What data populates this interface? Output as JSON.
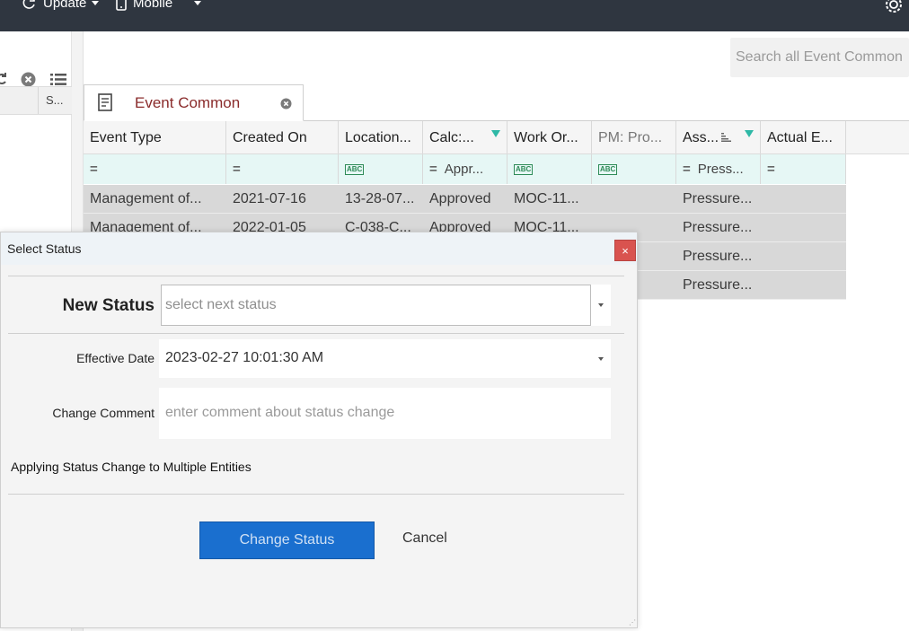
{
  "topbar": {
    "update_label": "Update",
    "mobile_label": "Mobile"
  },
  "left_pane": {
    "column_header": "S..."
  },
  "search": {
    "placeholder": "Search all Event Common"
  },
  "tab": {
    "title": "Event Common"
  },
  "grid": {
    "columns": [
      "Event Type",
      "Created On",
      "Location...",
      "Calc:...",
      "Work Or...",
      "PM: Pro...",
      "Ass...",
      "Actual E..."
    ],
    "filters": {
      "calc": "Appr...",
      "ass": "Press..."
    },
    "rows": [
      [
        "Management of...",
        "2021-07-16",
        "13-28-07...",
        "Approved",
        "MOC-11...",
        "",
        "Pressure...",
        ""
      ],
      [
        "Management of...",
        "2022-01-05",
        "C-038-C...",
        "Approved",
        "MOC-11...",
        "",
        "Pressure...",
        ""
      ],
      [
        "",
        "",
        "",
        "",
        "",
        "",
        "Pressure...",
        ""
      ],
      [
        "",
        "",
        "",
        "",
        "",
        "",
        "Pressure...",
        ""
      ]
    ]
  },
  "dialog": {
    "title": "Select Status",
    "close_glyph": "×",
    "new_status_label": "New Status",
    "new_status_placeholder": "select next status",
    "effective_date_label": "Effective Date",
    "effective_date_value": "2023-02-27 10:01:30 AM",
    "change_comment_label": "Change Comment",
    "change_comment_placeholder": "enter comment about status change",
    "multi_notice": "Applying Status Change to Multiple Entities",
    "change_button": "Change Status",
    "cancel_button": "Cancel"
  },
  "colors": {
    "topbar": "#2f3640",
    "tab_title": "#8a2b2b",
    "filter_row": "#e6f7f5",
    "primary_button": "#1a6fcf",
    "close_button": "#d9534f"
  }
}
